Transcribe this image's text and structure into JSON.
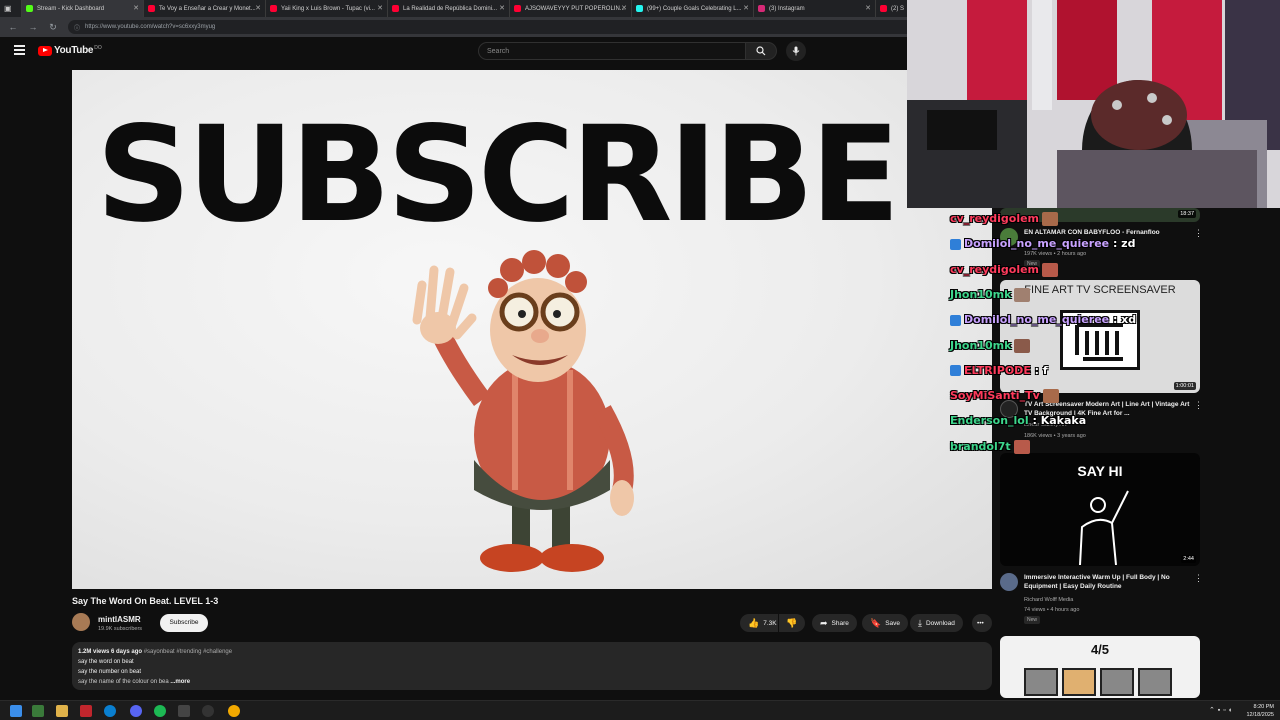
{
  "browser": {
    "tabs": [
      {
        "title": "Stream - Kick Dashboard",
        "fav_color": "#53fc18"
      },
      {
        "title": "Te Voy a Enseñar a Crear y Monet...",
        "fav_color": "#ff0033"
      },
      {
        "title": "Yaii King x Luis Brown - Tupac (vi...",
        "fav_color": "#ff0033"
      },
      {
        "title": "La Realidad de República Domini...",
        "fav_color": "#ff0033"
      },
      {
        "title": "AJSOWAVEYYY PUT POPEROLIN...",
        "fav_color": "#ff0033"
      },
      {
        "title": "(99+) Couple Goals Celebrating L...",
        "fav_color": "#25f4ee"
      },
      {
        "title": "(3) Instagram",
        "fav_color": "#d62976"
      },
      {
        "title": "(2) S",
        "fav_color": "#ff0033"
      }
    ],
    "url": "https://www.youtube.com/watch?v=sc6xxy3myug"
  },
  "youtube": {
    "logo_text": "YouTube",
    "logo_country": "DO",
    "search_placeholder": "Search",
    "video": {
      "big_text": "SUBSCRIBE",
      "title": "Say The Word On Beat. LEVEL 1-3",
      "channel_name": "mintlASMR",
      "subscribers": "19.9K subscribers",
      "subscribe_label": "Subscribe",
      "likes": "7.3K",
      "share_label": "Share",
      "save_label": "Save",
      "download_label": "Download",
      "description": {
        "meta": "1.2M views  6 days ago",
        "tags": "#sayonbeat #trending #challenge",
        "line1": "say the word on beat",
        "line2": "say the number on beat",
        "line3": "say the name of the colour on bea",
        "more": "...more"
      }
    },
    "recommendations": [
      {
        "title": "EN ALTAMAR CON BABYFLOO - Fernanfloo",
        "meta": "197K views • 2 hours ago",
        "badge": "New",
        "duration": "18:37"
      },
      {
        "title": "TV Art Screensaver Modern Art | Line Art | Vintage Art TV Background | 4K Fine Art for ...",
        "meta": "186K views • 3 years ago",
        "channel": "Linear Gallery Art",
        "duration": "1:00:01",
        "thumb_text": "FINE ART TV SCREENSAVER"
      },
      {
        "title": "Immersive Interactive Warm Up | Full Body | No Equipment | Easy Daily Routine",
        "channel": "Richard Wolff Media",
        "meta": "74 views • 4 hours ago",
        "badge": "New",
        "duration": "2:44",
        "thumb_text": "SAY HI"
      },
      {
        "thumb_text": "4/5"
      }
    ]
  },
  "chat": [
    {
      "user": "cv_reydigolem",
      "color": "#ff3b5c",
      "msg": "",
      "emote": true
    },
    {
      "user": "Domilol_no_me_quieree",
      "color": "#c8a2ff",
      "msg": " : zd",
      "badge": true
    },
    {
      "user": "cv_reydigolem",
      "color": "#ff3b5c",
      "msg": "",
      "emote": true
    },
    {
      "user": "Jhon10mk",
      "color": "#3dd68c",
      "msg": "",
      "emote": true
    },
    {
      "user": "Domilol_no_me_quieree",
      "color": "#c8a2ff",
      "msg": " : xd",
      "badge": true
    },
    {
      "user": "Jhon10mk",
      "color": "#3dd68c",
      "msg": "",
      "emote": true
    },
    {
      "user": "ELTRIPODE",
      "color": "#ff3b5c",
      "msg": " : f",
      "badge": true
    },
    {
      "user": "SoyMiSanti_Tv",
      "color": "#ff3b5c",
      "msg": "",
      "emote": true
    },
    {
      "user": "Enderson_lol",
      "color": "#3dd68c",
      "msg": " : Kakaka",
      "emote": false
    },
    {
      "user": "brandol7t",
      "color": "#3dd68c",
      "msg": "",
      "emote": true
    }
  ],
  "taskbar": {
    "time": "8:20 PM",
    "date": "12/18/2025"
  }
}
